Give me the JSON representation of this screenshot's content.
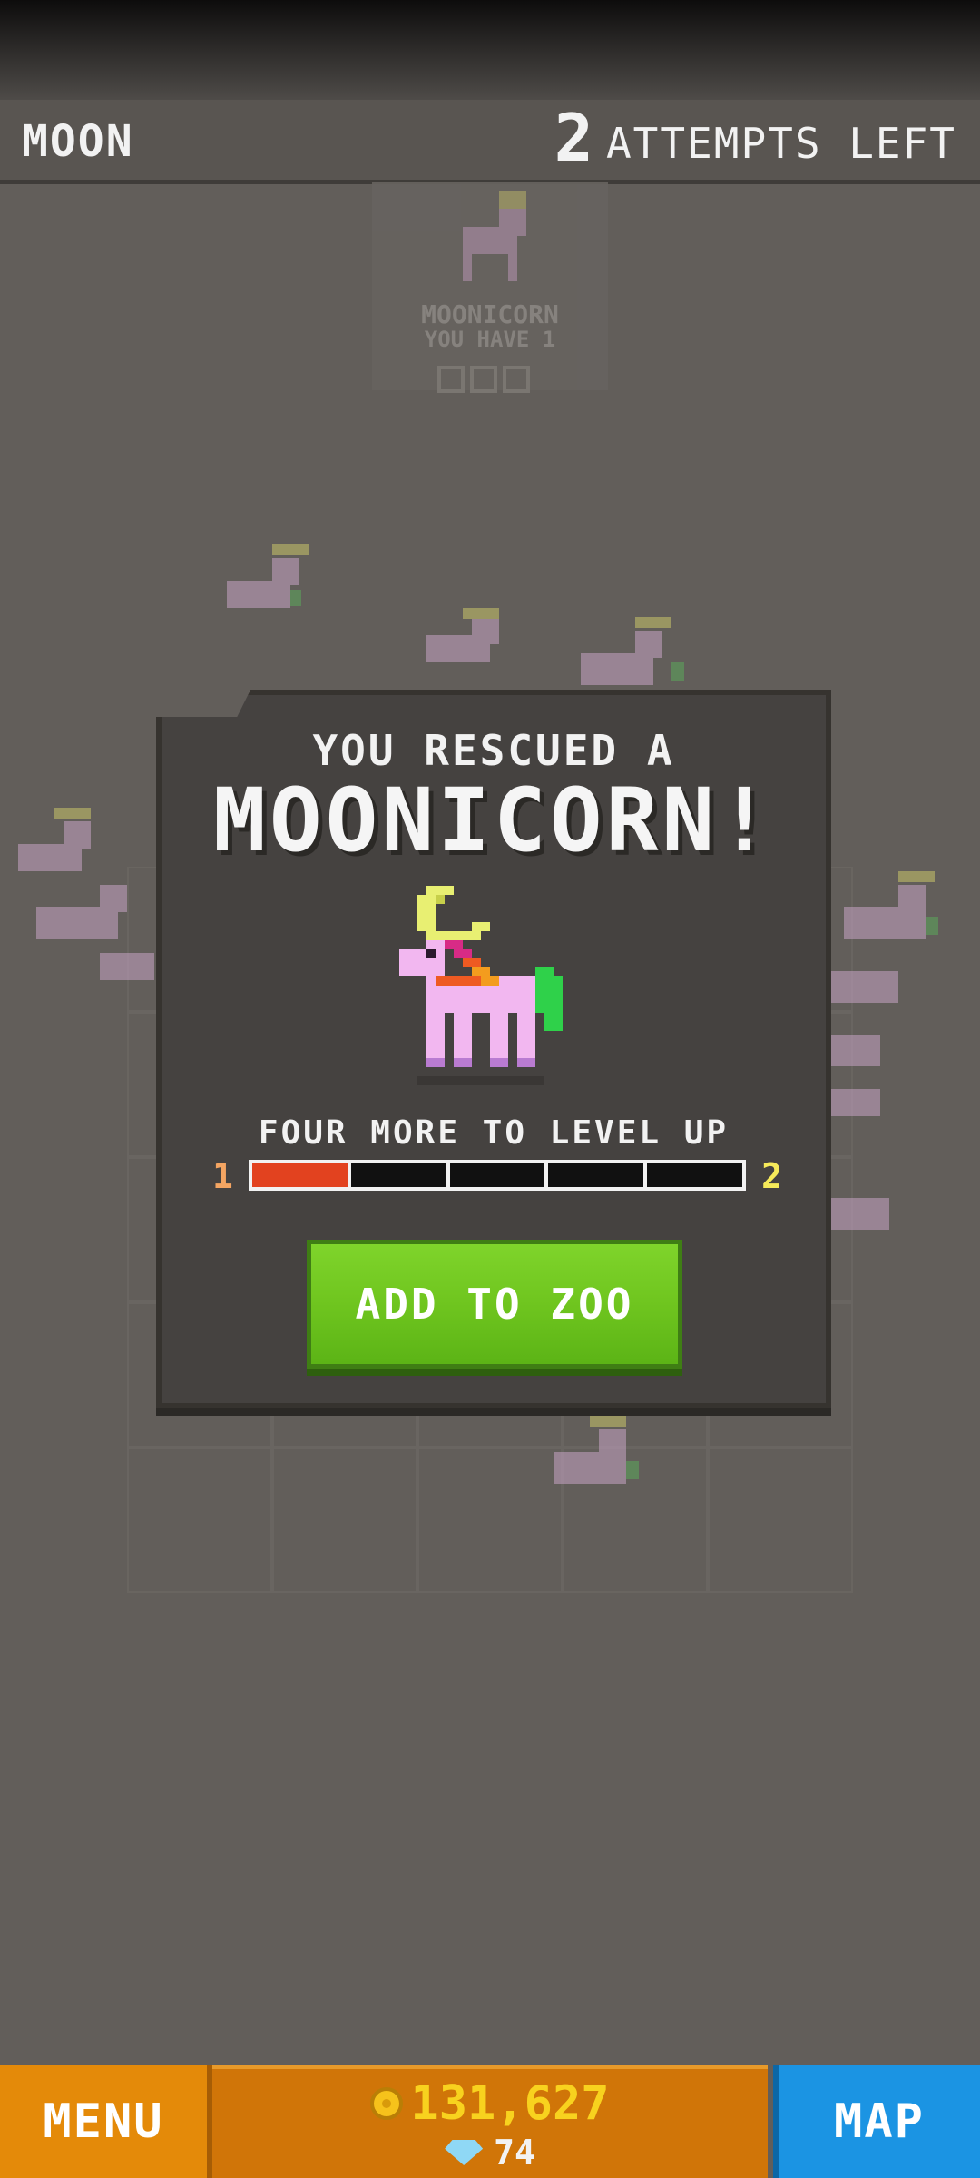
{
  "header": {
    "level_name": "MOON",
    "attempts_count": "2",
    "attempts_label": "ATTEMPTS LEFT"
  },
  "background_card": {
    "animal_name": "MOONICORN",
    "owned_text": "YOU HAVE 1"
  },
  "dialog": {
    "rescued_line": "YOU RESCUED A",
    "animal_title": "MOONICORN!",
    "levelup_text": "FOUR MORE TO LEVEL UP",
    "level_from": "1",
    "level_to": "2",
    "progress_segments": 5,
    "progress_filled_fraction": 0.2,
    "add_button_label": "ADD TO ZOO"
  },
  "footer": {
    "menu_label": "MENU",
    "coins": "131,627",
    "gems": "74",
    "map_label": "MAP"
  },
  "colors": {
    "button_green": "#6fc51f",
    "menu_orange": "#e48a09",
    "map_blue": "#1b94e3",
    "progress_fill": "#e2421f"
  }
}
